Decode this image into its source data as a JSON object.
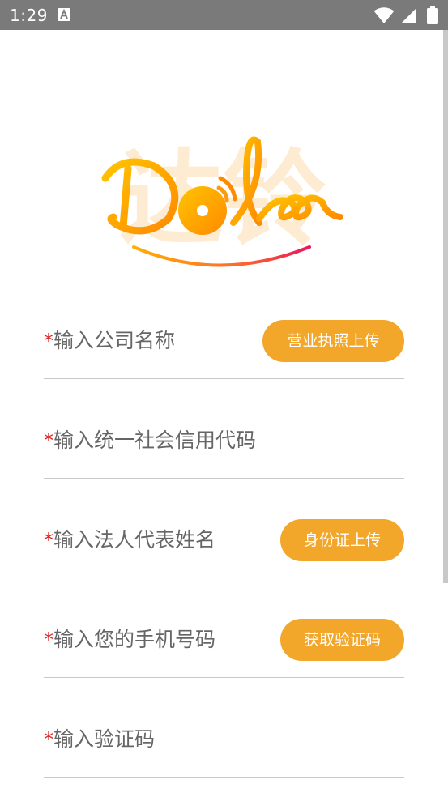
{
  "status_bar": {
    "time": "1:29"
  },
  "brand": {
    "watermark": "达铃",
    "logo_text": "Dolee"
  },
  "form": {
    "required_mark": "*",
    "company_name": {
      "placeholder": "输入公司名称",
      "action": "营业执照上传"
    },
    "credit_code": {
      "placeholder": "输入统一社会信用代码"
    },
    "legal_rep": {
      "placeholder": "输入法人代表姓名",
      "action": "身份证上传"
    },
    "phone": {
      "placeholder": "输入您的手机号码",
      "action": "获取验证码"
    },
    "verify_code": {
      "placeholder": "输入验证码"
    }
  },
  "colors": {
    "accent": "#f2a62a",
    "required": "#e02020",
    "status_bar": "#7a7a7a",
    "placeholder": "#666666",
    "divider": "#c9c9c9"
  }
}
